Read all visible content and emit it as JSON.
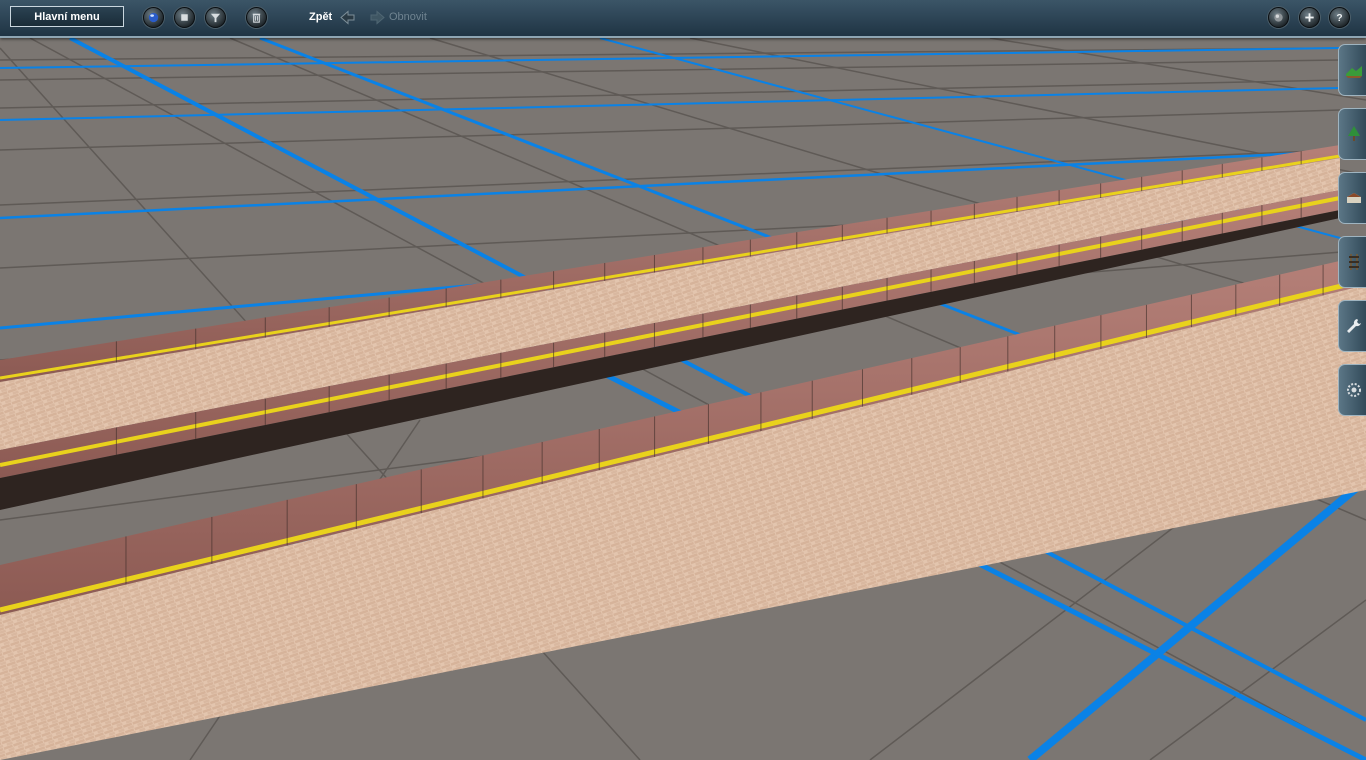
{
  "toolbar": {
    "main_menu_label": "Hlavní menu",
    "undo_label": "Zpět",
    "redo_label": "Obnovit",
    "left_icons": [
      "globe-icon",
      "stop-icon",
      "filter-icon",
      "trash-icon"
    ],
    "right_icons": [
      "sphere-icon",
      "plus-icon",
      "help-icon"
    ]
  },
  "side_tabs": [
    "terrain-tool-icon",
    "tree-tool-icon",
    "objects-tool-icon",
    "track-tool-icon",
    "wrench-icon",
    "settings-cog-icon"
  ],
  "colors": {
    "ground": "#7b7672",
    "grid_major": "#0a82e6",
    "grid_minor": "#5f5a56",
    "platform_edge": "#9e6a63",
    "platform_surface": "#e3c5ae",
    "yellow_line": "#e9d21c",
    "toolbar": "#2a4252"
  }
}
